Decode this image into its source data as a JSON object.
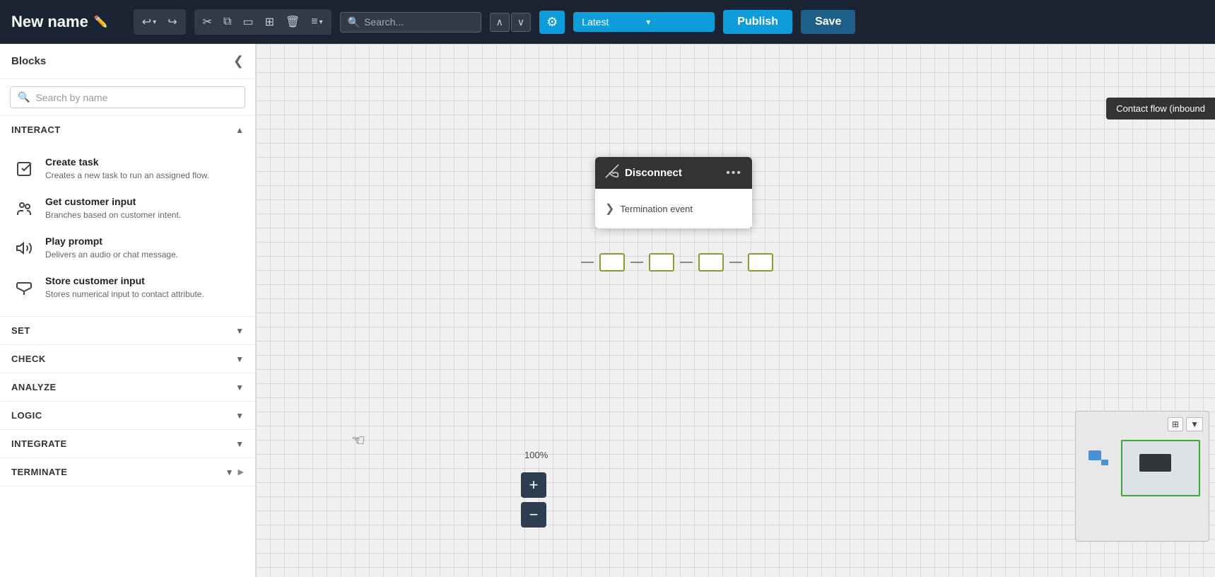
{
  "app": {
    "title": "New name",
    "edit_icon": "✏️"
  },
  "toolbar": {
    "undo_label": "↩",
    "undo_dropdown": "▾",
    "redo_label": "↪",
    "cut_label": "✂",
    "copy_label": "⧉",
    "frame_label": "▭",
    "grid_label": "⊞",
    "delete_label": "🗑",
    "text_label": "≡",
    "text_dropdown": "▾",
    "search_label": "🔍",
    "nav_up": "∧",
    "nav_down": "∨",
    "gear_label": "⚙",
    "version_label": "Latest",
    "version_arrow": "▾",
    "publish_label": "Publish",
    "save_label": "Save"
  },
  "sidebar": {
    "title": "Blocks",
    "collapse_icon": "❮",
    "search_placeholder": "Search by name",
    "sections": [
      {
        "id": "interact",
        "label": "INTERACT",
        "expanded": true,
        "items": [
          {
            "name": "Create task",
            "desc": "Creates a new task to run an assigned flow.",
            "icon": "task"
          },
          {
            "name": "Get customer input",
            "desc": "Branches based on customer intent.",
            "icon": "people"
          },
          {
            "name": "Play prompt",
            "desc": "Delivers an audio or chat message.",
            "icon": "speaker"
          },
          {
            "name": "Store customer input",
            "desc": "Stores numerical input to contact attribute.",
            "icon": "cloud"
          }
        ]
      },
      {
        "id": "set",
        "label": "SET",
        "expanded": false,
        "items": []
      },
      {
        "id": "check",
        "label": "CHECK",
        "expanded": false,
        "items": []
      },
      {
        "id": "analyze",
        "label": "ANALYZE",
        "expanded": false,
        "items": []
      },
      {
        "id": "logic",
        "label": "LOGIC",
        "expanded": false,
        "items": []
      },
      {
        "id": "integrate",
        "label": "INTEGRATE",
        "expanded": false,
        "items": []
      },
      {
        "id": "terminate",
        "label": "TERMINATE",
        "expanded": false,
        "items": []
      }
    ]
  },
  "canvas": {
    "disconnect_block": {
      "title": "Disconnect",
      "termination_event": "Termination event",
      "menu_dots": "•••"
    },
    "zoom_level": "100%",
    "zoom_in": "+",
    "zoom_out": "−"
  },
  "contact_flow_tooltip": "Contact flow (inbound",
  "minimap": {}
}
